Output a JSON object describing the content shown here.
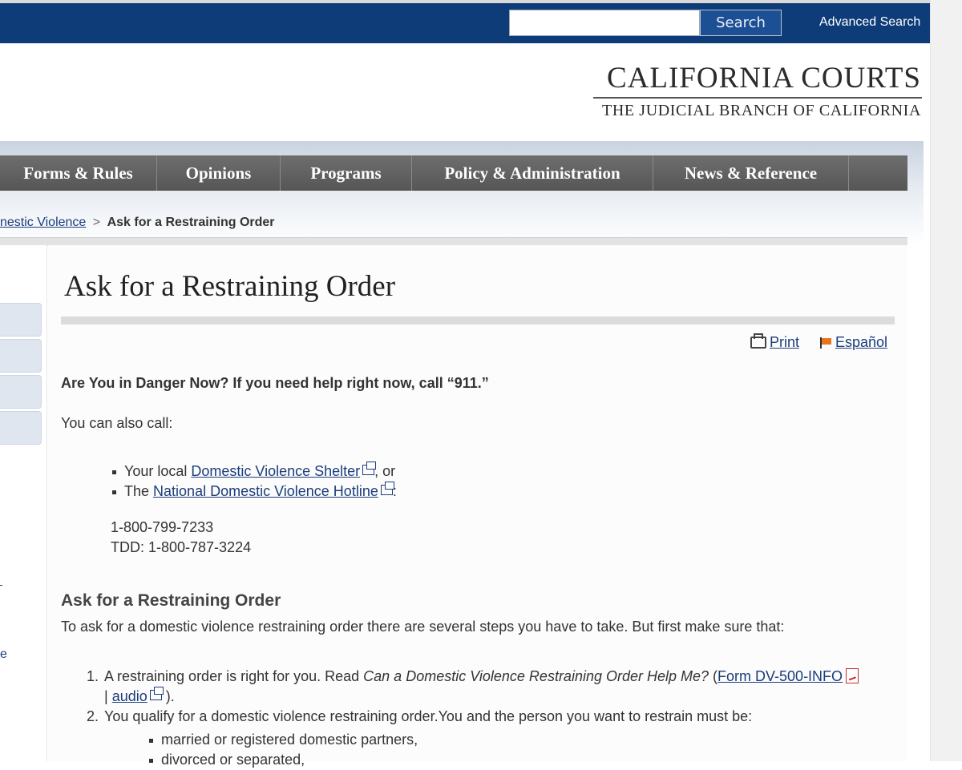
{
  "header": {
    "search_placeholder": "",
    "search_button": "Search",
    "advanced_search": "Advanced Search"
  },
  "branding": {
    "title": "CALIFORNIA COURTS",
    "subtitle": "THE JUDICIAL BRANCH OF CALIFORNIA"
  },
  "nav": {
    "items": [
      "Forms & Rules",
      "Opinions",
      "Programs",
      "Policy & Administration",
      "News & Reference"
    ]
  },
  "breadcrumb": {
    "parent": "nestic Violence",
    "separator": ">",
    "current": "Ask for a Restraining Order"
  },
  "page": {
    "title": "Ask for a Restraining Order",
    "print": "Print",
    "espanol": "Español",
    "danger": "Are You in Danger Now? If you need help right now, call “911.”",
    "also_call": "You can also call:",
    "call_list": [
      {
        "prefix": "Your local ",
        "link": "Domestic Violence Shelter",
        "suffix": ", or"
      },
      {
        "prefix": "The ",
        "link": "National Domestic Violence Hotline",
        "suffix": ":"
      }
    ],
    "phone": "1-800-799-7233",
    "tdd": "TDD: 1-800-787-3224",
    "section_heading": "Ask for a Restraining Order",
    "intro": "To ask for a domestic violence restraining order there are several steps you have to take. But first make sure that:",
    "steps": {
      "step1_num": "1.",
      "step1_text": "A restraining order is right for you. Read ",
      "step1_italic": "Can a Domestic Violence Restraining Order Help Me?",
      "step1_open": " (",
      "step1_form_link": "Form DV-500-INFO",
      "step1_pipe": "| ",
      "step1_audio_link": "audio",
      "step1_close": " ).",
      "step2_num": "2.",
      "step2_text": "You qualify for a domestic violence restraining order.You and the person you want to restrain must be:",
      "step2_sub": [
        "married or registered domestic partners,",
        "divorced or separated,"
      ]
    }
  },
  "left_edge": {
    "fragment": "e"
  }
}
